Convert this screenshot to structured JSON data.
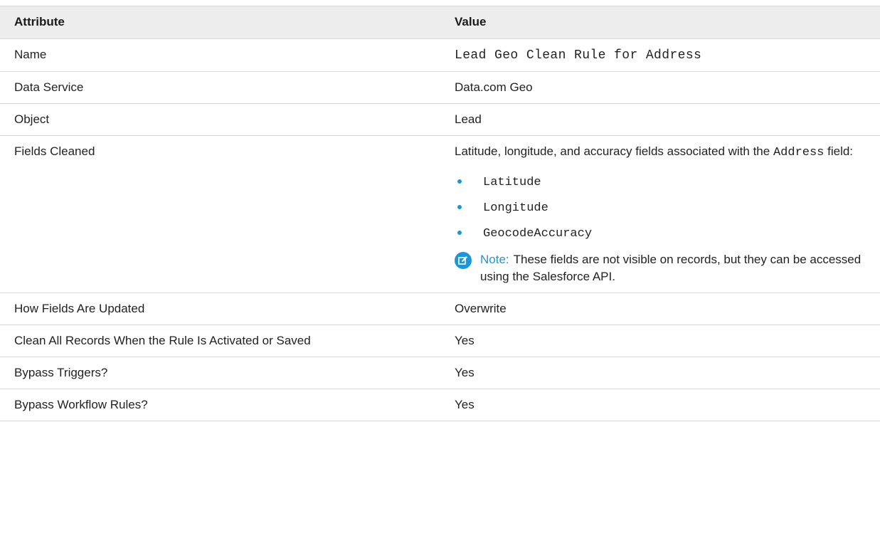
{
  "table": {
    "headers": [
      "Attribute",
      "Value"
    ],
    "rows": {
      "name": {
        "attribute": "Name",
        "value": "Lead Geo Clean Rule for Address"
      },
      "data_service": {
        "attribute": "Data Service",
        "value": "Data.com Geo"
      },
      "object": {
        "attribute": "Object",
        "value": "Lead"
      },
      "fields_cleaned": {
        "attribute": "Fields Cleaned",
        "desc_prefix": "Latitude, longitude, and accuracy fields associated with the",
        "desc_code": "Address",
        "desc_suffix": "field:",
        "fields": [
          "Latitude",
          "Longitude",
          "GeocodeAccuracy"
        ],
        "note_label": "Note:",
        "note_text": "These fields are not visible on records, but they can be accessed using the Salesforce API."
      },
      "how_updated": {
        "attribute": "How Fields Are Updated",
        "value": "Overwrite"
      },
      "clean_all": {
        "attribute": "Clean All Records When the Rule Is Activated or Saved",
        "value": "Yes"
      },
      "bypass_triggers": {
        "attribute": "Bypass Triggers?",
        "value": "Yes"
      },
      "bypass_workflow": {
        "attribute": "Bypass Workflow Rules?",
        "value": "Yes"
      }
    }
  },
  "colors": {
    "accent": "#1b96d9",
    "header_bg": "#ededed",
    "border": "#d6d6d6"
  },
  "icons": {
    "note": "edit-note-icon",
    "bullet": "bullet-dot"
  }
}
